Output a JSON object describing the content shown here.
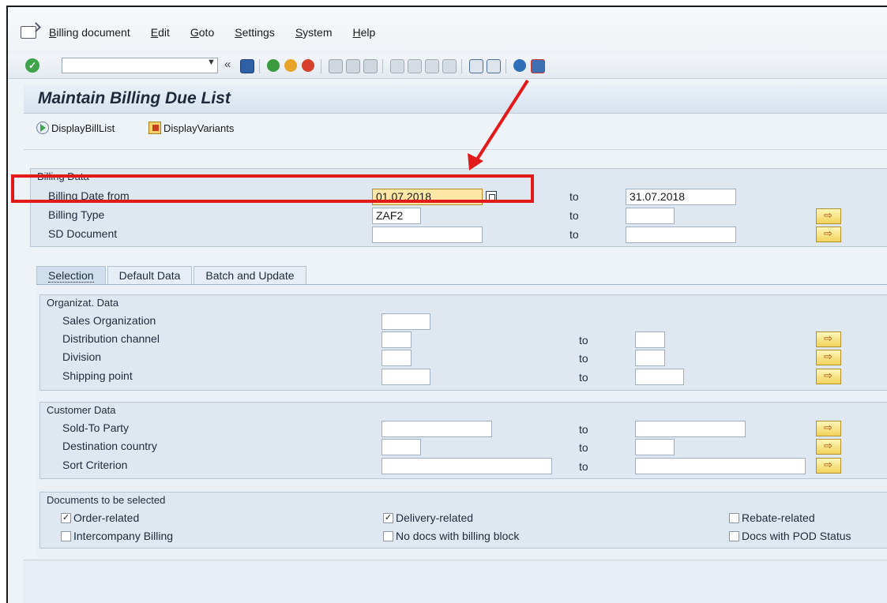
{
  "menu": {
    "items": [
      "Billing document",
      "Edit",
      "Goto",
      "Settings",
      "System",
      "Help"
    ]
  },
  "toolbar": {
    "command_field_value": "",
    "icons": [
      "enter-icon",
      "back-icon",
      "save-icon",
      "back-nav-icon",
      "exit-icon",
      "cancel-icon",
      "print-icon",
      "find-icon",
      "find-next-icon",
      "first-page-icon",
      "previous-page-icon",
      "next-page-icon",
      "last-page-icon",
      "create-session-icon",
      "shortcut-icon",
      "help-icon",
      "customize-layout-icon"
    ]
  },
  "page": {
    "title": "Maintain Billing Due List",
    "app_buttons": [
      "DisplayBillList",
      "DisplayVariants"
    ]
  },
  "billing_data": {
    "title": "Billing Data",
    "rows": [
      {
        "label": "Billing Date from",
        "from": "01.07.2018",
        "to_label": "to",
        "to": "31.07.2018"
      },
      {
        "label": "Billing Type",
        "from": "ZAF2",
        "to_label": "to",
        "to": ""
      },
      {
        "label": "SD Document",
        "from": "",
        "to_label": "to",
        "to": ""
      }
    ]
  },
  "tabs": [
    "Selection",
    "Default Data",
    "Batch and Update"
  ],
  "organizat_data": {
    "title": "Organizat. Data",
    "rows": [
      {
        "label": "Sales Organization",
        "from": ""
      },
      {
        "label": "Distribution channel",
        "from": "",
        "to_label": "to",
        "to": ""
      },
      {
        "label": "Division",
        "from": "",
        "to_label": "to",
        "to": ""
      },
      {
        "label": "Shipping point",
        "from": "",
        "to_label": "to",
        "to": ""
      }
    ]
  },
  "customer_data": {
    "title": "Customer Data",
    "rows": [
      {
        "label": "Sold-To Party",
        "from": "",
        "to_label": "to",
        "to": ""
      },
      {
        "label": "Destination country",
        "from": "",
        "to_label": "to",
        "to": ""
      },
      {
        "label": "Sort Criterion",
        "from": "",
        "to_label": "to",
        "to": ""
      }
    ]
  },
  "documents": {
    "title": "Documents to be selected",
    "checkboxes": [
      {
        "label": "Order-related",
        "checked": true
      },
      {
        "label": "Delivery-related",
        "checked": true
      },
      {
        "label": "Rebate-related",
        "checked": false
      },
      {
        "label": "Intercompany Billing",
        "checked": false
      },
      {
        "label": "No docs with billing block",
        "checked": false
      },
      {
        "label": "Docs with POD Status",
        "checked": false
      }
    ]
  },
  "colors": {
    "annotation": "#e21a1a",
    "highlight_field": "#fde6a6",
    "group_bg": "#dfe8f1"
  }
}
